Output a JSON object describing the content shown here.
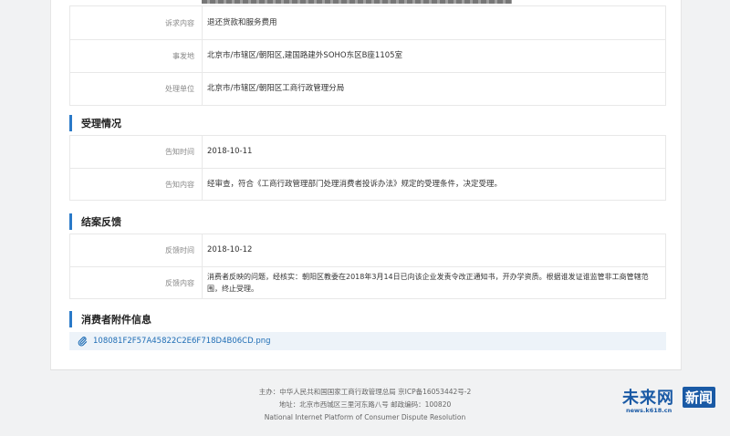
{
  "complaint": {
    "rows": [
      {
        "label": "诉求内容",
        "value": "退还货款和服务费用"
      },
      {
        "label": "事发地",
        "value": "北京市/市辖区/朝阳区,建国路建外SOHO东区B座1105室"
      },
      {
        "label": "处理单位",
        "value": "北京市/市辖区/朝阳区工商行政管理分局"
      }
    ]
  },
  "acceptance": {
    "title": "受理情况",
    "rows": [
      {
        "label": "告知时间",
        "value": "2018-10-11"
      },
      {
        "label": "告知内容",
        "value": "经审查，符合《工商行政管理部门处理消费者投诉办法》规定的受理条件，决定受理。"
      }
    ]
  },
  "closing": {
    "title": "结案反馈",
    "rows": [
      {
        "label": "反馈时间",
        "value": "2018-10-12"
      },
      {
        "label": "反馈内容",
        "value": "消费者反映的问题，经核实：朝阳区教委在2018年3月14日已向该企业发责令改正通知书，开办学资质。根据谁发证谁监管非工商管辖范围，终止受理。"
      }
    ]
  },
  "attachments": {
    "title": "消费者附件信息",
    "file": "108081F2F57A45822C2E6F718D4B06CD.png"
  },
  "footer": {
    "line1": "主办：中华人民共和国国家工商行政管理总局 京ICP备16053442号-2",
    "line2": "地址：北京市西城区三里河东路八号 邮政编码：100820",
    "line3": "National Internet Platform of Consumer Dispute Resolution"
  },
  "watermark": {
    "name": "未来网",
    "box": "新闻",
    "url": "news.k618.cn"
  },
  "colors": {
    "accent": "#2a7ac8",
    "link": "#1f6db5"
  }
}
